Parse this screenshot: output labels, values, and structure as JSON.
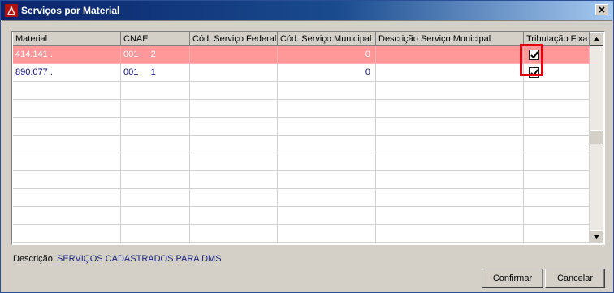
{
  "window": {
    "title": "Serviços por Material"
  },
  "grid": {
    "columns": [
      "Material",
      "CNAE",
      "Cód. Serviço Federal",
      "Cód. Serviço Municipal",
      "Descrição Serviço Municipal",
      "Tributação Fixa"
    ],
    "rows": [
      {
        "material": "414.141 .",
        "cnae": "001     2",
        "cod_federal": "",
        "cod_municipal": "0",
        "descricao": "",
        "tributacao_fixa": true
      },
      {
        "material": "890.077 .",
        "cnae": "001     1",
        "cod_federal": "",
        "cod_municipal": "0",
        "descricao": "",
        "tributacao_fixa": true
      }
    ]
  },
  "footer": {
    "descricao_label": "Descrição",
    "descricao_value": "SERVIÇOS CADASTRADOS PARA DMS"
  },
  "buttons": {
    "confirmar": "Confirmar",
    "cancelar": "Cancelar"
  },
  "colors": {
    "highlight_row": "#ff9999",
    "annotation_box": "#e3000f",
    "titlebar": "#0a246a"
  }
}
